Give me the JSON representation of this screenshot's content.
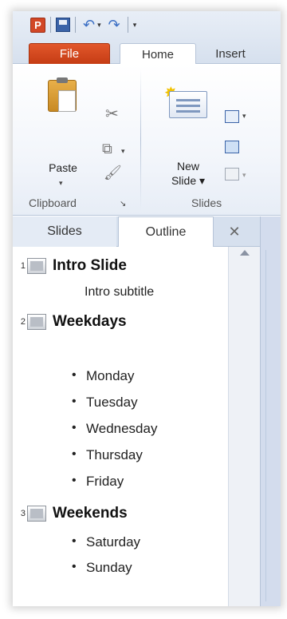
{
  "app": {
    "logo_letter": "P"
  },
  "qat": {
    "undo_glyph": "↶",
    "redo_glyph": "↷",
    "dropdown_glyph": "▾"
  },
  "tabs": [
    {
      "label": "File"
    },
    {
      "label": "Home"
    },
    {
      "label": "Insert"
    }
  ],
  "ribbon": {
    "clipboard": {
      "group_label": "Clipboard",
      "paste_label": "Paste",
      "paste_arrow": "▾"
    },
    "slides": {
      "group_label": "Slides",
      "new_slide_label_line1": "New",
      "new_slide_label_line2": "Slide ▾"
    }
  },
  "pane": {
    "tab_slides": "Slides",
    "tab_outline": "Outline",
    "close_glyph": "✕"
  },
  "outline": {
    "slides": [
      {
        "number": "1",
        "title": "Intro Slide",
        "subtitle": "Intro subtitle",
        "bullets": []
      },
      {
        "number": "2",
        "title": "Weekdays",
        "subtitle": "",
        "bullets": [
          "Monday",
          "Tuesday",
          "Wednesday",
          "Thursday",
          "Friday"
        ]
      },
      {
        "number": "3",
        "title": "Weekends",
        "subtitle": "",
        "bullets": [
          "Saturday",
          "Sunday"
        ]
      }
    ]
  },
  "colors": {
    "file_tab": "#d24726",
    "ribbon_bg": "#f3f6fb",
    "pane_bg": "#d6e0ee"
  }
}
